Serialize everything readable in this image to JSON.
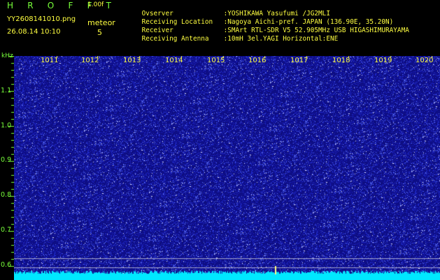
{
  "header": {
    "title": "H R O F F T",
    "version": "1.00f",
    "filename": "YY2608141010.png",
    "datetime": "26.08.14 10:10",
    "detect_label": "meteor",
    "detect_count": "5"
  },
  "info": [
    {
      "label": "Ovserver",
      "value": ":YOSHIKAWA Yasufumi /JG2MLI"
    },
    {
      "label": "Receiving Location",
      "value": ":Nagoya Aichi-pref. JAPAN (136.90E, 35.20N)"
    },
    {
      "label": "Receiver",
      "value": ":SMArt RTL-SDR V5 52.905MHz USB HIGASHIMURAYAMA"
    },
    {
      "label": "Receiving Antenna",
      "value": ":10mH 3el.YAGI Horizontal:ENE"
    }
  ],
  "axis": {
    "y_unit": "kHz",
    "y_ticks": [
      "1.1",
      "1.0",
      "0.9",
      "0.8",
      "0.7",
      "0.6"
    ],
    "x_ticks": [
      "1011",
      "1012",
      "1013",
      "1014",
      "1015",
      "1016",
      "1017",
      "1018",
      "1019",
      "1020"
    ]
  },
  "colors": {
    "background": "#000000",
    "header_green": "#78ff3a",
    "header_yellow": "#ffff40",
    "waterfall_base": "#10108a",
    "noise_floor": "#00e8ff"
  }
}
